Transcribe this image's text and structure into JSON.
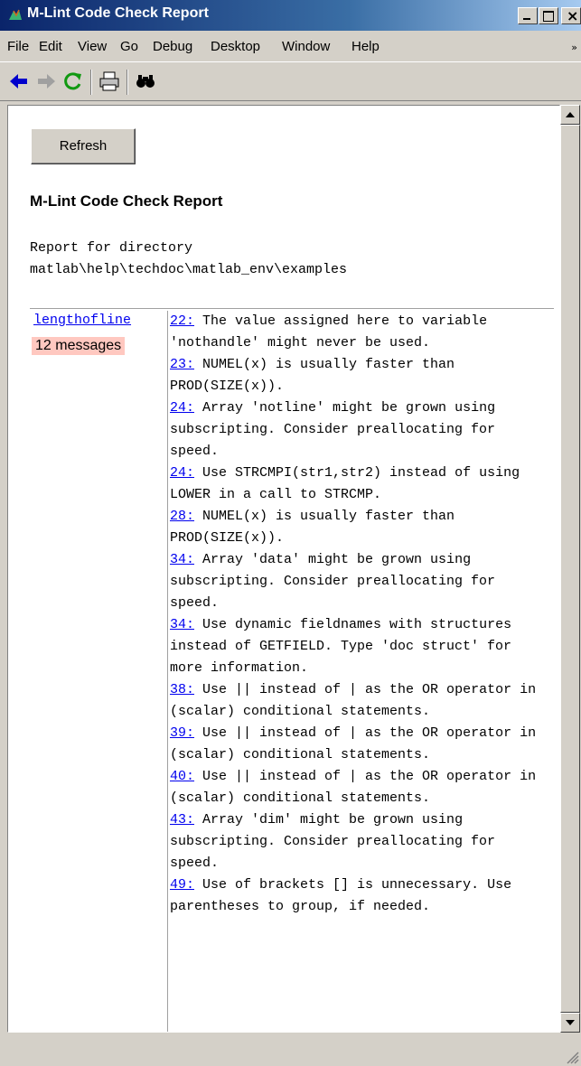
{
  "window": {
    "title": "M-Lint Code Check Report"
  },
  "menu": [
    "File",
    "Edit",
    "View",
    "Go",
    "Debug",
    "Desktop",
    "Window",
    "Help"
  ],
  "toolbar": {
    "icons": [
      "back-arrow-icon",
      "forward-arrow-icon",
      "refresh-icon",
      "print-icon",
      "find-icon"
    ]
  },
  "report": {
    "refresh_label": "Refresh",
    "title": "M-Lint Code Check Report",
    "directory_text": "Report for directory\nmatlab\\help\\techdoc\\matlab_env\\examples",
    "file": {
      "name": "lengthofline",
      "count": "12 messages"
    },
    "messages": [
      {
        "line": "22:",
        "text": " The value assigned here to variable 'nothandle' might never be used."
      },
      {
        "line": "23:",
        "text": " NUMEL(x) is usually faster than PROD(SIZE(x))."
      },
      {
        "line": "24:",
        "text": " Array 'notline' might be grown using subscripting. Consider preallocating for speed."
      },
      {
        "line": "24:",
        "text": " Use STRCMPI(str1,str2) instead of using LOWER in a call to STRCMP."
      },
      {
        "line": "28:",
        "text": " NUMEL(x) is usually faster than PROD(SIZE(x))."
      },
      {
        "line": "34:",
        "text": " Array 'data' might be grown using subscripting. Consider preallocating for speed."
      },
      {
        "line": "34:",
        "text": " Use dynamic fieldnames with structures instead of GETFIELD. Type 'doc struct' for more information."
      },
      {
        "line": "38:",
        "text": " Use || instead of | as the OR operator in (scalar) conditional statements."
      },
      {
        "line": "39:",
        "text": " Use || instead of | as the OR operator in (scalar) conditional statements."
      },
      {
        "line": "40:",
        "text": " Use || instead of | as the OR operator in (scalar) conditional statements."
      },
      {
        "line": "43:",
        "text": " Array 'dim' might be grown using subscripting. Consider preallocating for speed."
      },
      {
        "line": "49:",
        "text": " Use of brackets [] is unnecessary. Use parentheses to group, if needed."
      }
    ]
  }
}
